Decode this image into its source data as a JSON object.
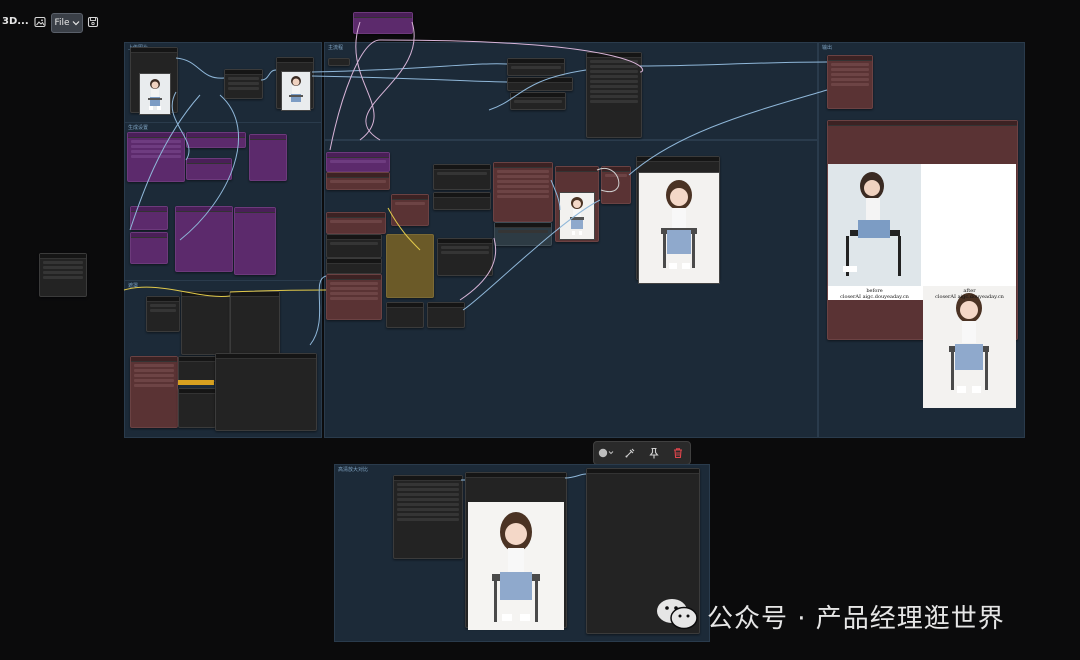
{
  "toolbar": {
    "title": "3D...",
    "file_label": "File",
    "icons": [
      "image-icon",
      "chevron-down-icon",
      "save-icon"
    ]
  },
  "groups": {
    "load_image": {
      "title": "上传图片"
    },
    "settings": {
      "title": "生成设置"
    },
    "mask": {
      "title": "遮罩"
    },
    "main": {
      "title": "主流程"
    },
    "output": {
      "title": "输出"
    },
    "bottom": {
      "title": "高清放大对比"
    }
  },
  "node_toolbar": {
    "icons": [
      "color-circle-icon",
      "chevron-down-icon",
      "bypass-icon",
      "pin-icon",
      "delete-icon"
    ],
    "colors": {
      "delete": "#e0454c"
    }
  },
  "comparison": {
    "before_label": "before",
    "before_site": "closerAI   aigc.douyeaday.cn",
    "after_label": "after",
    "after_site": "closerAI   aigc.douyeaday.cn"
  },
  "watermark": {
    "icon": "wechat-icon",
    "text": "公众号 · 产品经理逛世界"
  },
  "colors": {
    "background": "#0b0b0c",
    "group": "#1c2a38",
    "node": "#232323",
    "node_red": "#5a3334",
    "node_purple": "#5c2a6c",
    "node_olive": "#6b5a28",
    "wire_blue": "#8fb7d9",
    "wire_pink": "#d8b4d8",
    "wire_yellow": "#e0c84a"
  }
}
